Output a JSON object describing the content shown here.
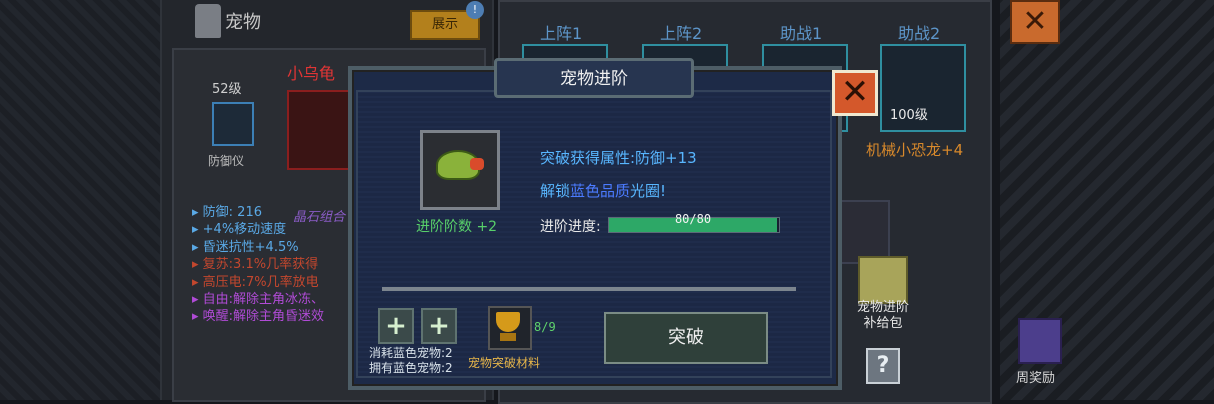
{
  "pet_panel": {
    "title": "宠物",
    "show_button": "展示",
    "badge": "!",
    "pet_name": "小乌龟",
    "level": "52级",
    "equip_label": "防御仪",
    "attributes": [
      {
        "text": "防御: 216",
        "color": "#5aa9e6"
      },
      {
        "text": "+4%移动速度",
        "color": "#5aa9e6"
      },
      {
        "text": "昏迷抗性+4.5%",
        "color": "#5aa9e6"
      },
      {
        "text": "复苏:3.1%几率获得",
        "color": "#c3472e"
      },
      {
        "text": "高压电:7%几率放电",
        "color": "#c3472e"
      },
      {
        "text": "自由:解除主角冰冻、",
        "color": "#b04bd6"
      },
      {
        "text": "唤醒:解除主角昏迷效",
        "color": "#b04bd6"
      }
    ],
    "gem_label": "晶石组合"
  },
  "lineup": {
    "slots": [
      "上阵1",
      "上阵2",
      "助战1",
      "助战2"
    ],
    "slot_level": "100级",
    "slot_name": "机械小恐龙+4",
    "slot_name_left": "8"
  },
  "gift_pack": {
    "label_line1": "宠物进阶",
    "label_line2": "补给包"
  },
  "help_label": "?",
  "top_close": "✕",
  "weekly_label": "周奖励",
  "modal": {
    "title": "宠物进阶",
    "close": "✕",
    "rank_label": "进阶阶数 +2",
    "break_attr": "突破获得属性:防御+13",
    "unlock_prefix": "解锁",
    "unlock_highlight": "蓝色品质",
    "unlock_suffix": "光圈!",
    "progress_label": "进阶进度:",
    "progress_text": "80/80",
    "progress_fraction": 1.0,
    "plus": "+",
    "consume_line1": "消耗蓝色宠物:2",
    "consume_line2": "拥有蓝色宠物:2",
    "material_count": "8/9",
    "material_label": "宠物突破材料",
    "break_button": "突破"
  },
  "colors": {
    "accent_green": "#2da867",
    "accent_blue": "#58b6ff",
    "close_orange": "#d4582b"
  }
}
